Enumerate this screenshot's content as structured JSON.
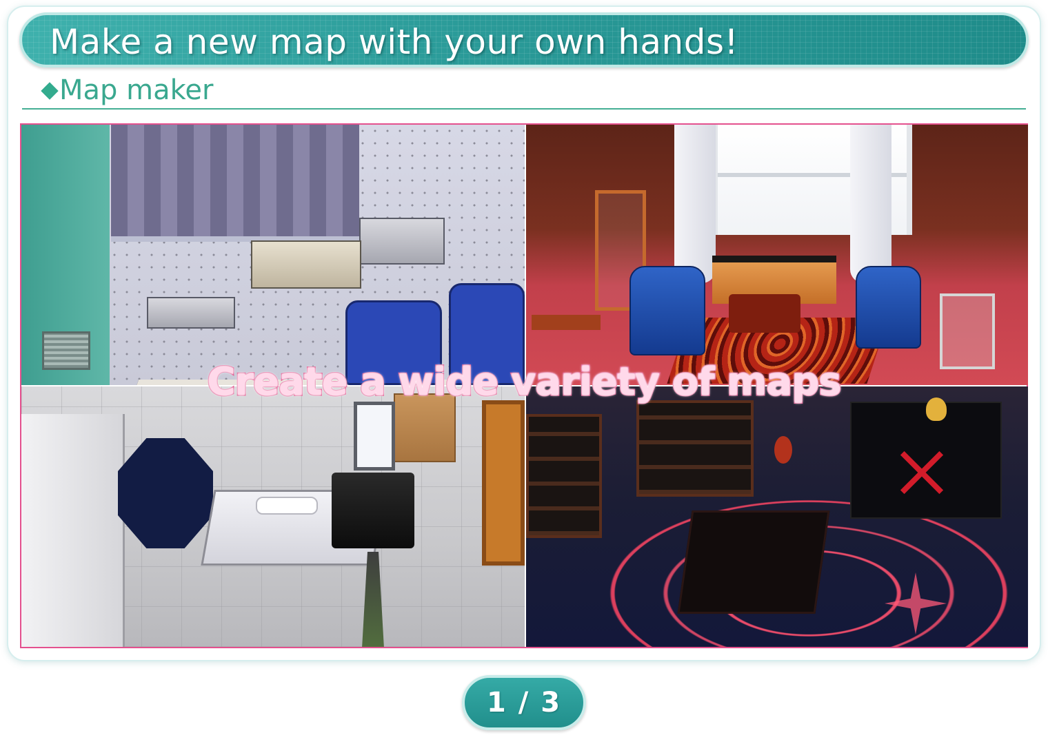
{
  "header": {
    "title": "Make a new map with your own hands!"
  },
  "section": {
    "label": "Map maker",
    "bullet_icon": "diamond-bullet-icon"
  },
  "gallery": {
    "caption": "Create a wide variety of maps",
    "screens": [
      {
        "name": "studio-sound-room-screenshot"
      },
      {
        "name": "principal-office-screenshot"
      },
      {
        "name": "photo-studio-bedroom-screenshot"
      },
      {
        "name": "occult-magic-circle-room-screenshot"
      }
    ]
  },
  "pagination": {
    "text": "1 / 3",
    "current": 1,
    "total": 3
  },
  "colors": {
    "accent": "#2a9a98",
    "heading_green": "#3aa88f",
    "frame_pink": "#e4508e"
  }
}
